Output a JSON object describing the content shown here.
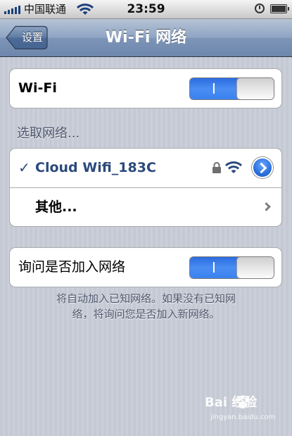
{
  "status_bar": {
    "carrier": "中国联通",
    "time": "23:59"
  },
  "nav": {
    "back_label": "设置",
    "title": "Wi-Fi 网络"
  },
  "wifi_group": {
    "label": "Wi-Fi",
    "switch_on_label": "I",
    "enabled": true
  },
  "networks": {
    "section_header": "选取网络...",
    "items": [
      {
        "name": "Cloud Wifi_183C",
        "selected": true,
        "secured": true
      },
      {
        "name": "其他..."
      }
    ],
    "check_mark": "✓"
  },
  "ask_group": {
    "label": "询问是否加入网络",
    "switch_on_label": "I",
    "enabled": true
  },
  "footer_note": {
    "line1": "将自动加入已知网络。如果没有已知网",
    "line2": "络，将询问您是否加入新网络。"
  },
  "watermark": {
    "brand": "Bai  经验",
    "url": "jingyan.baidu.com"
  },
  "colors": {
    "switch_blue": "#3b82f0",
    "selected_text": "#2b4a7c",
    "background": "#c7cbd5"
  }
}
